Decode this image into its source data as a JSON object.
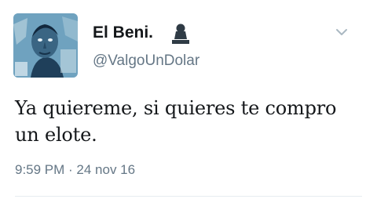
{
  "tweet": {
    "display_name": "El Beni.",
    "handle": "@ValgoUnDolar",
    "text": "Ya quiereme, si quieres te compro un elote.",
    "timestamp": "9:59 PM · 24 nov 16",
    "verified_icon": "user-silhouette-icon",
    "menu_icon": "chevron-down-icon"
  },
  "colors": {
    "name": "#14171a",
    "secondary": "#657786",
    "divider": "#e6ecf0",
    "avatar_bg": "#6fa3c0"
  }
}
